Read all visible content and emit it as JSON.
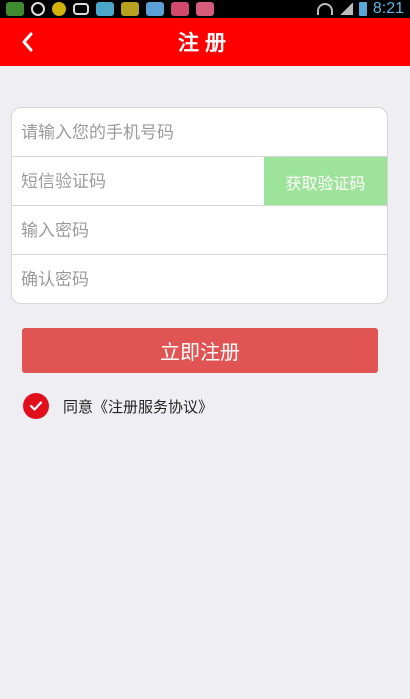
{
  "status_bar": {
    "time": "8:21"
  },
  "header": {
    "title": "注册",
    "back_icon": "chevron-left-icon"
  },
  "form": {
    "phone_placeholder": "请输入您的手机号码",
    "sms_code_placeholder": "短信验证码",
    "sms_button_label": "获取验证码",
    "password_placeholder": "输入密码",
    "confirm_password_placeholder": "确认密码"
  },
  "actions": {
    "register_label": "立即注册"
  },
  "agreement": {
    "checked": true,
    "prefix": "同意",
    "link_text": "《注册服务协议》"
  },
  "colors": {
    "header_bg": "#ff0000",
    "register_button": "#e05454",
    "sms_button": "#9ee39a",
    "checkbox": "#e10f1b",
    "page_bg": "#efeef3"
  }
}
